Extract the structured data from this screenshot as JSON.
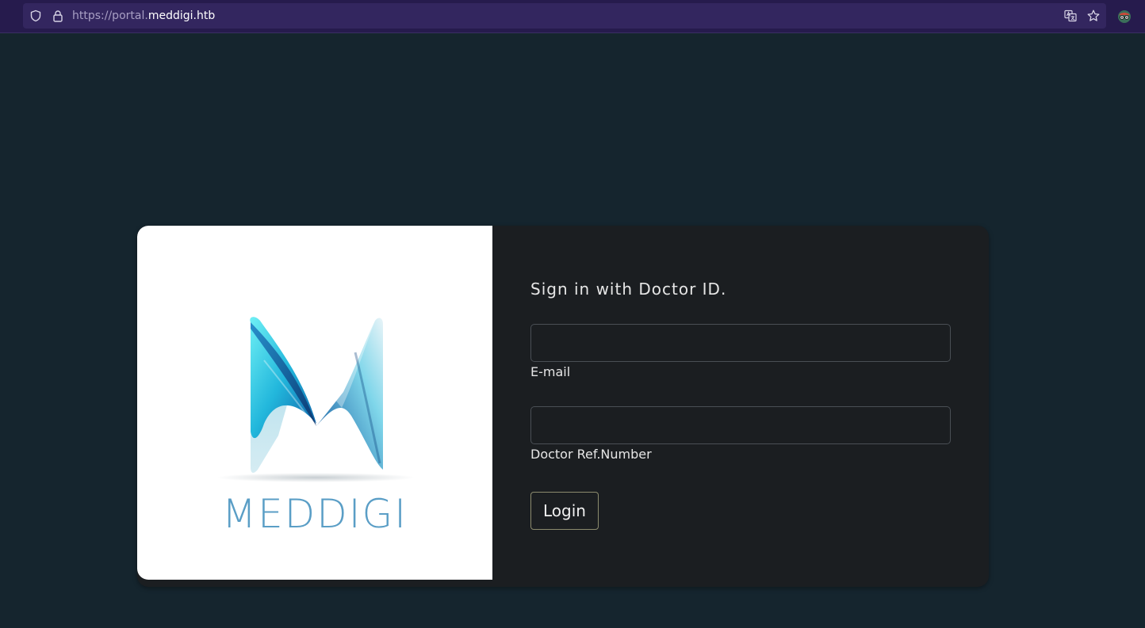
{
  "browser": {
    "url_prefix": "https://portal.",
    "url_domain": "meddigi.htb",
    "icons": [
      "shield-icon",
      "lock-icon",
      "translate-icon",
      "star-icon",
      "extension-icon"
    ]
  },
  "logo": {
    "wordmark": "MEDDIGI",
    "colors": {
      "light_cyan": "#5fe3f2",
      "mid_blue": "#1b86c9",
      "dark_blue": "#0a3f7a",
      "wordmark": "#5a9ec6"
    }
  },
  "login_form": {
    "heading": "Sign in with Doctor ID.",
    "email_label": "E-mail",
    "email_value": "",
    "ref_label": "Doctor Ref.Number",
    "ref_value": "",
    "login_label": "Login"
  },
  "colors": {
    "page_background": "#15252e",
    "browser_bar": "#261b4d",
    "card_background": "#1b1e21",
    "button_border": "#8c8b6e"
  }
}
